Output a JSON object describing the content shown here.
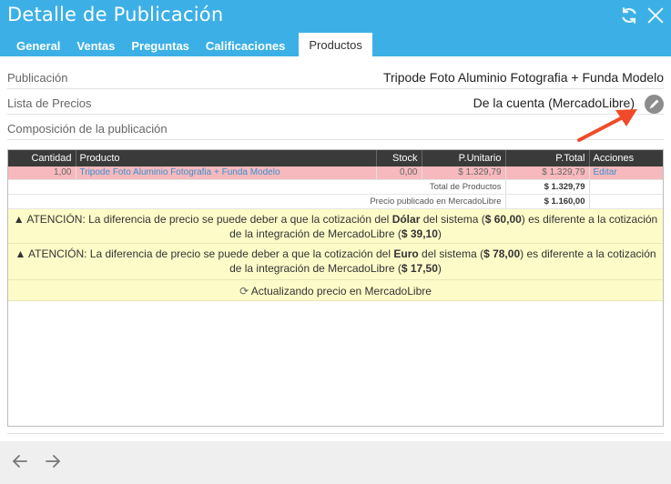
{
  "window": {
    "title": "Detalle de Publicación"
  },
  "tabs": [
    {
      "label": "General"
    },
    {
      "label": "Ventas"
    },
    {
      "label": "Preguntas"
    },
    {
      "label": "Calificaciones"
    },
    {
      "label": "Productos"
    }
  ],
  "details": {
    "publicacion_label": "Publicación",
    "publicacion_value": "Tripode Foto Aluminio Fotografia + Funda Modelo",
    "lista_label": "Lista de Precios",
    "lista_value": "De la cuenta (MercadoLibre)",
    "composicion_label": "Composición de la publicación"
  },
  "table": {
    "headers": [
      "Cantidad",
      "Producto",
      "Stock",
      "P.Unitario",
      "P.Total",
      "Acciones"
    ],
    "row": {
      "cantidad": "1,00",
      "producto": "Tripode Foto Aluminio Fotografia + Funda Modelo",
      "stock": "0,00",
      "unitario": "$ 1.329,79",
      "total": "$ 1.329,79",
      "accion": "Editar"
    },
    "total_label": "Total de Productos",
    "total_value": "$ 1.329,79",
    "published_label": "Precio publicado en MercadoLibre",
    "published_value": "$ 1.160,00"
  },
  "warnings": {
    "w1_pre": "ATENCIÓN: La diferencia de precio se puede deber a que la cotización del",
    "w1_currency": "Dólar",
    "w1_mid": "del sistema (",
    "w1_system": "$ 60,00",
    "w1_post": ") es diferente a la cotización de la integración de MercadoLibre (",
    "w1_integration": "$ 39,10",
    "w2_pre": "ATENCIÓN: La diferencia de precio se puede deber a que la cotización del",
    "w2_currency": "Euro",
    "w2_mid": "del sistema (",
    "w2_system": "$ 78,00",
    "w2_post": ") es diferente a la cotización de la integración de MercadoLibre (",
    "w2_integration": "$ 17,50",
    "close_paren": ")",
    "updating": "Actualizando precio en MercadoLibre"
  },
  "icons": {
    "refresh": "refresh-icon",
    "close": "close-icon",
    "edit": "pencil-icon",
    "back": "arrow-left-icon",
    "forward": "arrow-right-icon",
    "warning": "warning-icon"
  },
  "colors": {
    "header": "#3cb0e6",
    "table_header": "#3a3a3a",
    "product_row": "#f7b9bd",
    "warning_bg": "#fdfcc9",
    "annotation_arrow": "#f04a2a"
  }
}
